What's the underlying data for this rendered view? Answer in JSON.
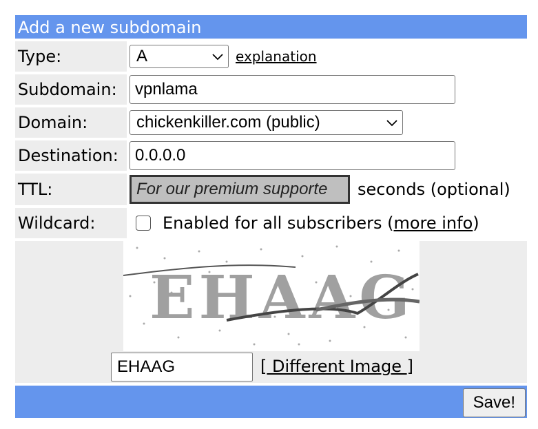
{
  "header": {
    "title": "Add a new subdomain"
  },
  "fields": {
    "type": {
      "label": "Type:",
      "value": "A",
      "explanation_link": "explanation"
    },
    "subdomain": {
      "label": "Subdomain:",
      "value": "vpnlama"
    },
    "domain": {
      "label": "Domain:",
      "value": "chickenkiller.com (public)"
    },
    "destination": {
      "label": "Destination:",
      "value": "0.0.0.0"
    },
    "ttl": {
      "label": "TTL:",
      "value": "For our premium supporte",
      "suffix": "seconds (optional)"
    },
    "wildcard": {
      "label": "Wildcard:",
      "text_before": "Enabled for all subscribers (",
      "link": "more info",
      "text_after": ")",
      "checked": false
    }
  },
  "captcha": {
    "image_text": "EHAAG",
    "input_value": "EHAAG",
    "bracket_open": "[",
    "different_image": " Different Image ",
    "bracket_close": "]"
  },
  "footer": {
    "save_label": "Save!"
  },
  "colors": {
    "header": "#6495ed",
    "label_bg": "#ededed",
    "ttl_bg": "#bfbfbf"
  }
}
